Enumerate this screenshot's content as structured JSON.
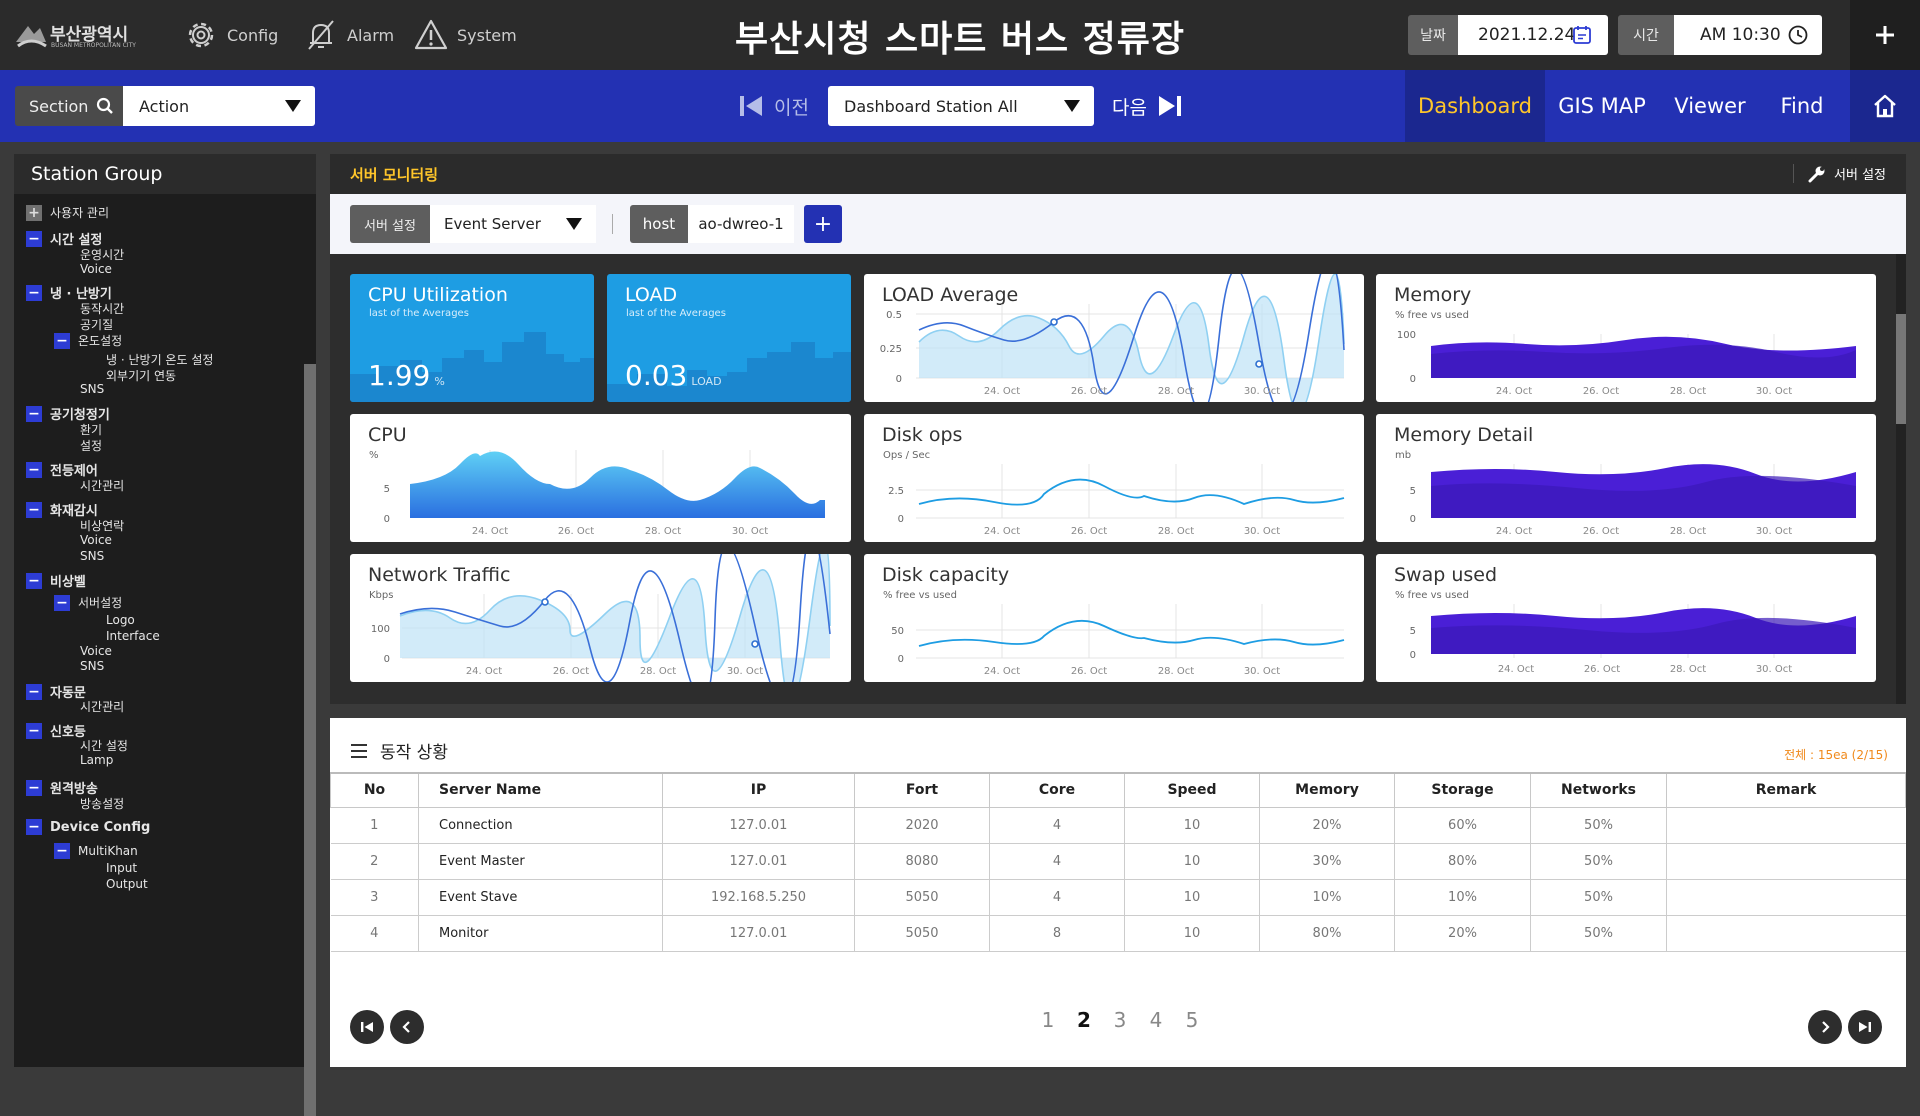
{
  "header": {
    "logo_korean": "부산광역시",
    "logo_english": "BUSAN METROPOLITAN CITY",
    "nav": [
      {
        "label": "Config",
        "icon": "gear-icon"
      },
      {
        "label": "Alarm",
        "icon": "bell-off-icon"
      },
      {
        "label": "System",
        "icon": "warning-icon"
      }
    ],
    "title": "부산시청 스마트 버스 정류장",
    "date_label": "날짜",
    "date_value": "2021.12.24",
    "time_label": "시간",
    "time_value": "AM 10:30"
  },
  "navbar": {
    "section_label": "Section",
    "action_value": "Action",
    "prev_label": "이전",
    "dashboard_select": "Dashboard Station All",
    "next_label": "다음",
    "tabs": [
      "Dashboard",
      "GIS MAP",
      "Viewer",
      "Find"
    ],
    "active_tab": "Dashboard"
  },
  "sidebar": {
    "title": "Station Group",
    "items": [
      {
        "label": "사용자 관리",
        "level": 0,
        "toggle": "plus",
        "bold": false
      },
      {
        "label": "시간 설정",
        "level": 0,
        "toggle": "minus",
        "bold": true
      },
      {
        "label": "운영시간",
        "level": 1
      },
      {
        "label": "Voice",
        "level": 1
      },
      {
        "label": "냉 · 난방기",
        "level": 0,
        "toggle": "minus",
        "bold": true
      },
      {
        "label": "동작시간",
        "level": 1
      },
      {
        "label": "공기질",
        "level": 1
      },
      {
        "label": "온도설정",
        "level": 1,
        "toggle": "minus"
      },
      {
        "label": "냉 · 난방기 온도 설정",
        "level": 2
      },
      {
        "label": "외부기기 연동",
        "level": 2
      },
      {
        "label": "SNS",
        "level": 1
      },
      {
        "label": "공기청정기",
        "level": 0,
        "toggle": "minus",
        "bold": true
      },
      {
        "label": "환기",
        "level": 1
      },
      {
        "label": "설정",
        "level": 1
      },
      {
        "label": "전등제어",
        "level": 0,
        "toggle": "minus",
        "bold": true
      },
      {
        "label": "시간관리",
        "level": 1
      },
      {
        "label": "화재감시",
        "level": 0,
        "toggle": "minus",
        "bold": true
      },
      {
        "label": "비상연락",
        "level": 1
      },
      {
        "label": "Voice",
        "level": 1
      },
      {
        "label": "SNS",
        "level": 1
      },
      {
        "label": "비상벨",
        "level": 0,
        "toggle": "minus",
        "bold": true
      },
      {
        "label": "서버설정",
        "level": 1,
        "toggle": "minus"
      },
      {
        "label": "Logo",
        "level": 2
      },
      {
        "label": "Interface",
        "level": 2
      },
      {
        "label": "Voice",
        "level": 1
      },
      {
        "label": "SNS",
        "level": 1
      },
      {
        "label": "자동문",
        "level": 0,
        "toggle": "minus",
        "bold": true
      },
      {
        "label": "시간관리",
        "level": 1
      },
      {
        "label": "신호등",
        "level": 0,
        "toggle": "minus",
        "bold": true
      },
      {
        "label": "시간 설정",
        "level": 1
      },
      {
        "label": "Lamp",
        "level": 1
      },
      {
        "label": "원격방송",
        "level": 0,
        "toggle": "minus",
        "bold": true
      },
      {
        "label": "방송설정",
        "level": 1
      },
      {
        "label": "Device Config",
        "level": 0,
        "toggle": "minus",
        "bold": true
      },
      {
        "label": "MultiKhan",
        "level": 1,
        "toggle": "minus"
      },
      {
        "label": "Input",
        "level": 2
      },
      {
        "label": "Output",
        "level": 2
      }
    ]
  },
  "monitor": {
    "title": "서버 모니터링",
    "settings_label": "서버 설정",
    "filter_label": "서버 설정",
    "filter_value": "Event Server",
    "host_label": "host",
    "host_value": "ao-dwreo-1",
    "add_symbol": "+",
    "x_ticks": [
      "24. Oct",
      "26. Oct",
      "28. Oct",
      "30. Oct"
    ]
  },
  "cards": {
    "cpu_util": {
      "title": "CPU Utilization",
      "subtitle": "last of the Averages",
      "value": "1.99",
      "unit": "%"
    },
    "load": {
      "title": "LOAD",
      "subtitle": "last of the Averages",
      "value": "0.03",
      "unit": "LOAD"
    },
    "load_avg": {
      "title": "LOAD Average",
      "subtitle": "",
      "y_ticks": [
        "0.5",
        "0.25",
        "0"
      ]
    },
    "memory": {
      "title": "Memory",
      "subtitle": "% free vs used",
      "y_ticks": [
        "100",
        "0"
      ]
    },
    "cpu": {
      "title": "CPU",
      "subtitle": "%",
      "y_ticks": [
        "5",
        "0"
      ]
    },
    "disk_ops": {
      "title": "Disk ops",
      "subtitle": "Ops / Sec",
      "y_ticks": [
        "2.5",
        "0"
      ]
    },
    "memory_detail": {
      "title": "Memory Detail",
      "subtitle": "mb",
      "y_ticks": [
        "5",
        "0"
      ]
    },
    "network": {
      "title": "Network Traffic",
      "subtitle": "Kbps",
      "y_ticks": [
        "100",
        "0"
      ]
    },
    "disk_capacity": {
      "title": "Disk capacity",
      "subtitle": "% free vs used",
      "y_ticks": [
        "50",
        "0"
      ]
    },
    "swap": {
      "title": "Swap used",
      "subtitle": "% free vs used",
      "y_ticks": [
        "5",
        "0"
      ]
    }
  },
  "status": {
    "title": "동작 상황",
    "count": "전체 : 15ea  (2/15)",
    "columns": [
      "No",
      "Server Name",
      "IP",
      "Fort",
      "Core",
      "Speed",
      "Memory",
      "Storage",
      "Networks",
      "Remark"
    ],
    "rows": [
      [
        "1",
        "Connection",
        "127.0.01",
        "2020",
        "4",
        "10",
        "20%",
        "60%",
        "50%",
        ""
      ],
      [
        "2",
        "Event Master",
        "127.0.01",
        "8080",
        "4",
        "10",
        "30%",
        "80%",
        "50%",
        ""
      ],
      [
        "3",
        "Event Stave",
        "192.168.5.250",
        "5050",
        "4",
        "10",
        "10%",
        "10%",
        "50%",
        ""
      ],
      [
        "4",
        "Monitor",
        "127.0.01",
        "5050",
        "8",
        "10",
        "80%",
        "20%",
        "50%",
        ""
      ]
    ],
    "pages": [
      "1",
      "2",
      "3",
      "4",
      "5"
    ],
    "current_page": "2"
  },
  "colors": {
    "topbar": "#2b2b2b",
    "navbar": "#2331b3",
    "accent_yellow": "#ffc62a",
    "card_blue": "#1e9de3",
    "chart_line": "#1e9de3",
    "chart_purple": "#4a1fd6",
    "count_orange": "#f08a1c"
  }
}
